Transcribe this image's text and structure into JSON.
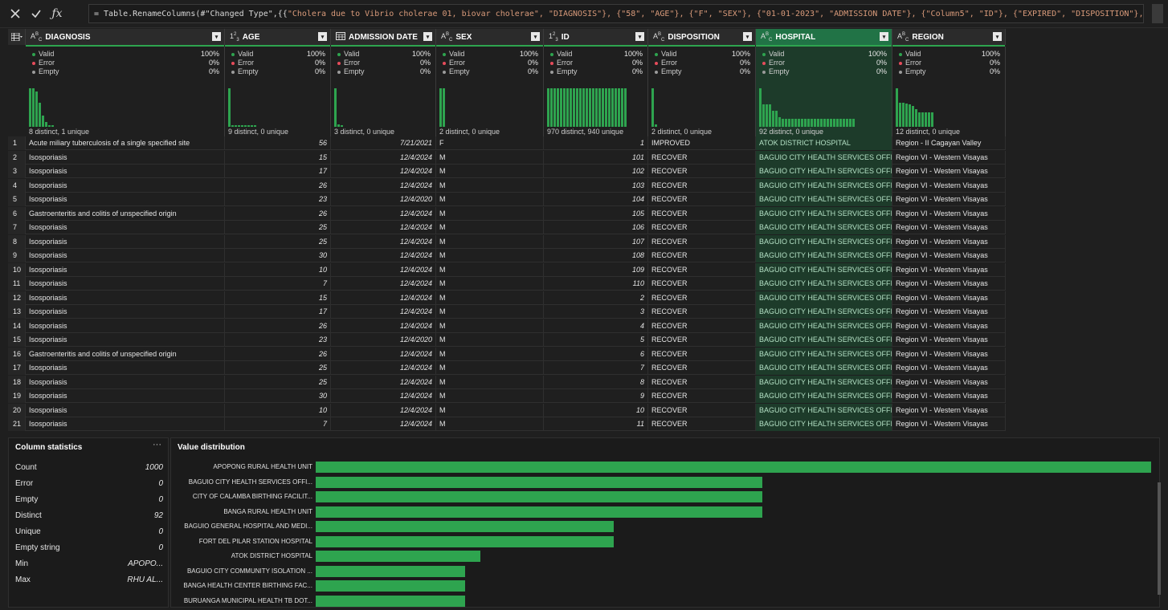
{
  "formula": {
    "prefix": "= Table.RenameColumns(#\"Changed Type\",{{",
    "body": "\"Cholera due to Vibrio cholerae 01, biovar cholerae\", \"DIAGNOSIS\"}, {\"58\", \"AGE\"}, {\"F\", \"SEX\"}, {\"01-01-2023\", \"ADMISSION DATE\"}, {\"Column5\", \"ID\"}, {\"EXPIRED\", \"DISPOSITION\"}, {\"RHU ALABEL\","
  },
  "columns": [
    {
      "name": "DIAGNOSIS",
      "type_icon": "ABC",
      "valid": "100%",
      "error": "0%",
      "empty": "0%",
      "summary": "8 distinct, 1 unique",
      "hist": [
        48,
        48,
        44,
        30,
        14,
        6,
        2,
        2
      ]
    },
    {
      "name": "AGE",
      "type_icon": "123",
      "valid": "100%",
      "error": "0%",
      "empty": "0%",
      "summary": "9 distinct, 0 unique",
      "hist": [
        48,
        2,
        2,
        2,
        2,
        2,
        2,
        2,
        2
      ]
    },
    {
      "name": "ADMISSION DATE",
      "type_icon": "date",
      "valid": "100%",
      "error": "0%",
      "empty": "0%",
      "summary": "3 distinct, 0 unique",
      "hist": [
        48,
        3,
        2
      ]
    },
    {
      "name": "SEX",
      "type_icon": "ABC",
      "valid": "100%",
      "error": "0%",
      "empty": "0%",
      "summary": "2 distinct, 0 unique",
      "hist": [
        48,
        48
      ]
    },
    {
      "name": "ID",
      "type_icon": "123",
      "valid": "100%",
      "error": "0%",
      "empty": "0%",
      "summary": "970 distinct, 940 unique",
      "hist": [
        48,
        48,
        48,
        48,
        48,
        48,
        48,
        48,
        48,
        48,
        48,
        48,
        48,
        48,
        48,
        48,
        48,
        48,
        48,
        48,
        48,
        48,
        48,
        48,
        48
      ]
    },
    {
      "name": "DISPOSITION",
      "type_icon": "ABC",
      "valid": "100%",
      "error": "0%",
      "empty": "0%",
      "summary": "2 distinct, 0 unique",
      "hist": [
        48,
        3
      ]
    },
    {
      "name": "HOSPITAL",
      "type_icon": "ABC",
      "valid": "100%",
      "error": "0%",
      "empty": "0%",
      "summary": "92 distinct, 0 unique",
      "hist": [
        48,
        28,
        28,
        28,
        20,
        20,
        12,
        10,
        10,
        10,
        10,
        10,
        10,
        10,
        10,
        10,
        10,
        10,
        10,
        10,
        10,
        10,
        10,
        10,
        10,
        10,
        10,
        10,
        10,
        10
      ]
    },
    {
      "name": "REGION",
      "type_icon": "ABC",
      "valid": "100%",
      "error": "0%",
      "empty": "0%",
      "summary": "12 distinct, 0 unique",
      "hist": [
        48,
        30,
        30,
        29,
        28,
        26,
        22,
        18,
        18,
        18,
        18,
        18
      ]
    }
  ],
  "labels": {
    "valid": "Valid",
    "error": "Error",
    "empty": "Empty"
  },
  "rows": [
    [
      "1",
      "Acute miliary tuberculosis of a single specified site",
      "56",
      "7/21/2021",
      "F",
      "1",
      "IMPROVED",
      "ATOK DISTRICT HOSPITAL",
      "Region - II Cagayan Valley"
    ],
    [
      "2",
      "Isosporiasis",
      "15",
      "12/4/2024",
      "M",
      "101",
      "RECOVER",
      "BAGUIO CITY HEALTH SERVICES OFFICE",
      "Region VI - Western Visayas"
    ],
    [
      "3",
      "Isosporiasis",
      "17",
      "12/4/2024",
      "M",
      "102",
      "RECOVER",
      "BAGUIO CITY HEALTH SERVICES OFFICE",
      "Region VI - Western Visayas"
    ],
    [
      "4",
      "Isosporiasis",
      "26",
      "12/4/2024",
      "M",
      "103",
      "RECOVER",
      "BAGUIO CITY HEALTH SERVICES OFFICE",
      "Region VI - Western Visayas"
    ],
    [
      "5",
      "Isosporiasis",
      "23",
      "12/4/2020",
      "M",
      "104",
      "RECOVER",
      "BAGUIO CITY HEALTH SERVICES OFFICE",
      "Region VI - Western Visayas"
    ],
    [
      "6",
      "Gastroenteritis and colitis of unspecified origin",
      "26",
      "12/4/2024",
      "M",
      "105",
      "RECOVER",
      "BAGUIO CITY HEALTH SERVICES OFFICE",
      "Region VI - Western Visayas"
    ],
    [
      "7",
      "Isosporiasis",
      "25",
      "12/4/2024",
      "M",
      "106",
      "RECOVER",
      "BAGUIO CITY HEALTH SERVICES OFFICE",
      "Region VI - Western Visayas"
    ],
    [
      "8",
      "Isosporiasis",
      "25",
      "12/4/2024",
      "M",
      "107",
      "RECOVER",
      "BAGUIO CITY HEALTH SERVICES OFFICE",
      "Region VI - Western Visayas"
    ],
    [
      "9",
      "Isosporiasis",
      "30",
      "12/4/2024",
      "M",
      "108",
      "RECOVER",
      "BAGUIO CITY HEALTH SERVICES OFFICE",
      "Region VI - Western Visayas"
    ],
    [
      "10",
      "Isosporiasis",
      "10",
      "12/4/2024",
      "M",
      "109",
      "RECOVER",
      "BAGUIO CITY HEALTH SERVICES OFFICE",
      "Region VI - Western Visayas"
    ],
    [
      "11",
      "Isosporiasis",
      "7",
      "12/4/2024",
      "M",
      "110",
      "RECOVER",
      "BAGUIO CITY HEALTH SERVICES OFFICE",
      "Region VI - Western Visayas"
    ],
    [
      "12",
      "Isosporiasis",
      "15",
      "12/4/2024",
      "M",
      "2",
      "RECOVER",
      "BAGUIO CITY HEALTH SERVICES OFFICE",
      "Region VI - Western Visayas"
    ],
    [
      "13",
      "Isosporiasis",
      "17",
      "12/4/2024",
      "M",
      "3",
      "RECOVER",
      "BAGUIO CITY HEALTH SERVICES OFFICE",
      "Region VI - Western Visayas"
    ],
    [
      "14",
      "Isosporiasis",
      "26",
      "12/4/2024",
      "M",
      "4",
      "RECOVER",
      "BAGUIO CITY HEALTH SERVICES OFFICE",
      "Region VI - Western Visayas"
    ],
    [
      "15",
      "Isosporiasis",
      "23",
      "12/4/2020",
      "M",
      "5",
      "RECOVER",
      "BAGUIO CITY HEALTH SERVICES OFFICE",
      "Region VI - Western Visayas"
    ],
    [
      "16",
      "Gastroenteritis and colitis of unspecified origin",
      "26",
      "12/4/2024",
      "M",
      "6",
      "RECOVER",
      "BAGUIO CITY HEALTH SERVICES OFFICE",
      "Region VI - Western Visayas"
    ],
    [
      "17",
      "Isosporiasis",
      "25",
      "12/4/2024",
      "M",
      "7",
      "RECOVER",
      "BAGUIO CITY HEALTH SERVICES OFFICE",
      "Region VI - Western Visayas"
    ],
    [
      "18",
      "Isosporiasis",
      "25",
      "12/4/2024",
      "M",
      "8",
      "RECOVER",
      "BAGUIO CITY HEALTH SERVICES OFFICE",
      "Region VI - Western Visayas"
    ],
    [
      "19",
      "Isosporiasis",
      "30",
      "12/4/2024",
      "M",
      "9",
      "RECOVER",
      "BAGUIO CITY HEALTH SERVICES OFFICE",
      "Region VI - Western Visayas"
    ],
    [
      "20",
      "Isosporiasis",
      "10",
      "12/4/2024",
      "M",
      "10",
      "RECOVER",
      "BAGUIO CITY HEALTH SERVICES OFFICE",
      "Region VI - Western Visayas"
    ],
    [
      "21",
      "Isosporiasis",
      "7",
      "12/4/2024",
      "M",
      "11",
      "RECOVER",
      "BAGUIO CITY HEALTH SERVICES OFFICE",
      "Region VI - Western Visayas"
    ]
  ],
  "stats": {
    "title": "Column statistics",
    "items": [
      {
        "label": "Count",
        "value": "1000"
      },
      {
        "label": "Error",
        "value": "0"
      },
      {
        "label": "Empty",
        "value": "0"
      },
      {
        "label": "Distinct",
        "value": "92"
      },
      {
        "label": "Unique",
        "value": "0"
      },
      {
        "label": "Empty string",
        "value": "0"
      },
      {
        "label": "Min",
        "value": "APOPO..."
      },
      {
        "label": "Max",
        "value": "RHU AL..."
      }
    ]
  },
  "value_distribution": {
    "title": "Value distribution",
    "items": [
      {
        "label": "APOPONG RURAL HEALTH UNIT",
        "value": 1.0
      },
      {
        "label": "BAGUIO CITY HEALTH SERVICES OFFI...",
        "value": 0.535
      },
      {
        "label": "CITY OF CALAMBA BIRTHING FACILIT...",
        "value": 0.535
      },
      {
        "label": "BANGA RURAL HEALTH UNIT",
        "value": 0.535
      },
      {
        "label": "BAGUIO GENERAL HOSPITAL AND MEDI...",
        "value": 0.357
      },
      {
        "label": "FORT DEL PILAR STATION HOSPITAL",
        "value": 0.357
      },
      {
        "label": "ATOK DISTRICT HOSPITAL",
        "value": 0.197
      },
      {
        "label": "BAGUIO CITY COMMUNITY ISOLATION ...",
        "value": 0.179
      },
      {
        "label": "BANGA HEALTH CENTER BIRTHING FAC...",
        "value": 0.179
      },
      {
        "label": "BURUANGA MUNICIPAL HEALTH TB DOT...",
        "value": 0.179
      }
    ]
  },
  "colors": {
    "accent": "#2ea44f",
    "selected_header": "#217346",
    "selected_cell": "#1d3b2a",
    "valid": "#2ea44f",
    "error": "#e74c5b",
    "empty": "#9b9b9b"
  }
}
